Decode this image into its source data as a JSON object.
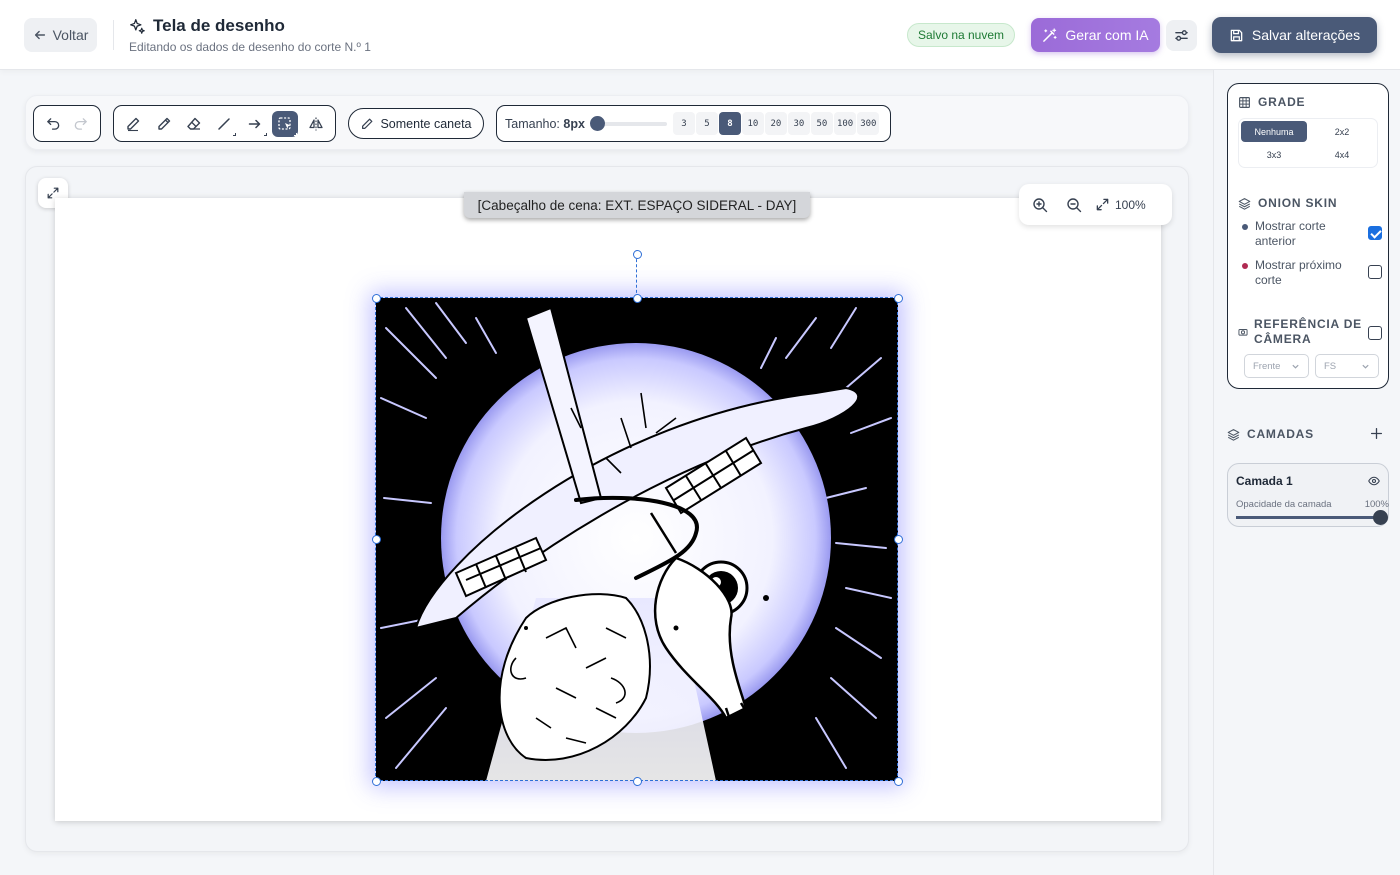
{
  "header": {
    "back_label": "Voltar",
    "title": "Tela de desenho",
    "subtitle": "Editando os dados de desenho do corte N.º 1",
    "saved_badge": "Salvo na nuvem",
    "ai_button": "Gerar com IA",
    "save_button": "Salvar alterações"
  },
  "toolbar": {
    "pen_only": "Somente caneta",
    "size_label": "Tamanho:",
    "size_value": "8px",
    "size_level": 0.03,
    "presets": [
      "3",
      "5",
      "8",
      "10",
      "20",
      "30",
      "50",
      "100",
      "300"
    ],
    "active_preset": "8"
  },
  "canvas": {
    "scene_header": "[Cabeçalho de cena: EXT. ESPAÇO SIDERAL - DAY]",
    "zoom": "100%"
  },
  "panel": {
    "grid_title": "GRADE",
    "grid_options": [
      "Nenhuma",
      "2x2",
      "3x3",
      "4x4"
    ],
    "grid_active": "Nenhuma",
    "onion_title": "ONION SKIN",
    "show_prev": "Mostrar corte anterior",
    "show_next": "Mostrar próximo corte",
    "camera_title": "REFERÊNCIA DE CÂMERA",
    "camera_angle": "Frente",
    "camera_shot": "FS",
    "layers_title": "CAMADAS",
    "layer_name": "Camada 1",
    "opacity_label": "Opacidade da camada",
    "opacity_value": "100%",
    "opacity_level": 1.0
  },
  "colors": {
    "accent": "#4a5a78",
    "ai_purple": "#a57be0",
    "checkbox_blue": "#1a6fe0",
    "prev_dot": "#4a5a78",
    "next_dot": "#b02a52"
  }
}
